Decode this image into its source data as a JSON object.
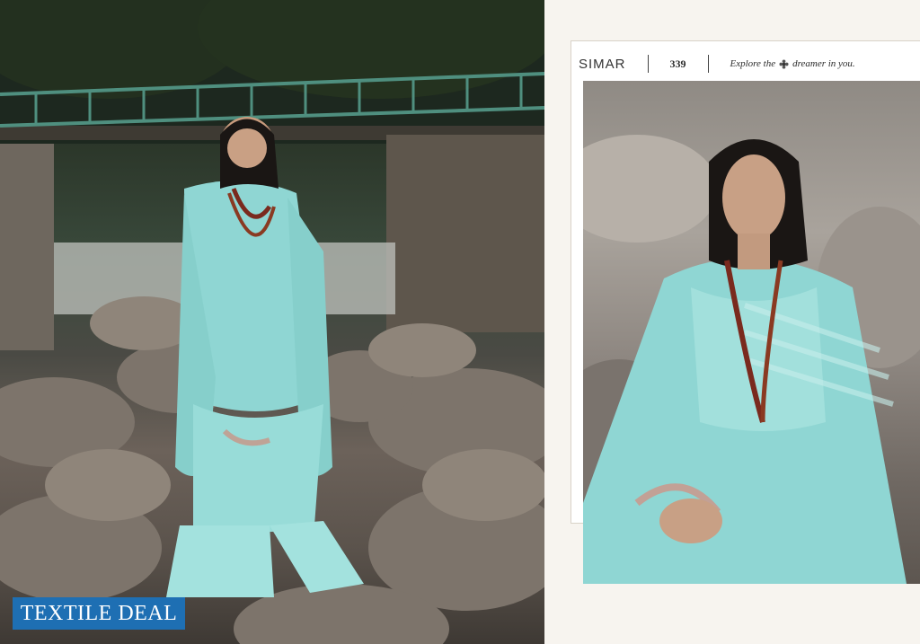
{
  "catalog": {
    "brand": "SIMAR",
    "number": "339",
    "tagline_before": "Explore the",
    "tagline_after": "dreamer in you."
  },
  "badge": {
    "label": "TEXTILE DEAL"
  },
  "colors": {
    "badge": "#1e6fb3",
    "outfit": "#8fd6d3",
    "panel": "#f7f4ef"
  },
  "icons": {
    "tagline_icon": "flower-icon"
  }
}
